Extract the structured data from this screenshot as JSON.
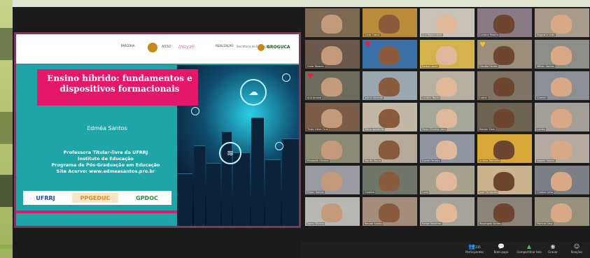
{
  "slide": {
    "title": "Ensino híbrido: fundamentos e dispositivos formacionais",
    "author": "Edméa Santos",
    "affiliation_lines": [
      "Professora Titular-livre da UFRRJ",
      "Instituto de Educação",
      "Programa de Pós-Graduação em Educação",
      "Site Acervo: www.edmeasantos.pro.br"
    ],
    "header_labels": {
      "partnership": "PARCERIA",
      "realization": "REALIZAÇÃO"
    },
    "header_logos": [
      "ASSO",
      "Inbyzê",
      "Secretaria de Educação",
      "GROGUCA"
    ],
    "footer_logos": [
      "UFRRJ",
      "PPGEDUC",
      "GPDOC"
    ]
  },
  "participants": [
    {
      "name": ""
    },
    {
      "name": "Carla Cabral"
    },
    {
      "name": "Ana Nascimento"
    },
    {
      "name": "Luciene Pereira"
    },
    {
      "name": "Nogueira Leite"
    },
    {
      "name": "Carla Tavares"
    },
    {
      "name": ""
    },
    {
      "name": "Raissa Lopes"
    },
    {
      "name": "Claudio Fontes"
    },
    {
      "name": "Willian Santos"
    },
    {
      "name": "Ana Amaral"
    },
    {
      "name": "Joilma Almeida"
    },
    {
      "name": "Luciana Rocha"
    },
    {
      "name": "Luana"
    },
    {
      "name": "Carmen"
    },
    {
      "name": "Thais Vieira Cruz"
    },
    {
      "name": "Maria Aparecida"
    },
    {
      "name": "Paula Oliveira Lima"
    },
    {
      "name": "Ramon Silva"
    },
    {
      "name": "Lurdes"
    },
    {
      "name": "Elisabete Oliveira"
    },
    {
      "name": "Marilia Souza"
    },
    {
      "name": "Daniel Ferreira"
    },
    {
      "name": "Andrea Ramalho"
    },
    {
      "name": "Isabela Santos"
    },
    {
      "name": "Edson Santos"
    },
    {
      "name": "Carolina"
    },
    {
      "name": "Lucia"
    },
    {
      "name": "Jose Fernandes"
    },
    {
      "name": "Cristina Lima"
    },
    {
      "name": "Joana Oliveira"
    },
    {
      "name": "Renata Santos"
    },
    {
      "name": "Rafael Medeiros"
    },
    {
      "name": "Rosangela Santos"
    },
    {
      "name": "Patricia Lima"
    }
  ],
  "toolbar": {
    "items": [
      {
        "label": "Participantes",
        "count": "235",
        "icon": "people-icon"
      },
      {
        "label": "Bate-papo",
        "icon": "chat-icon"
      },
      {
        "label": "Compartilhar tela",
        "icon": "share-screen-icon"
      },
      {
        "label": "Gravar",
        "icon": "record-icon"
      },
      {
        "label": "Reações",
        "icon": "reactions-icon"
      }
    ]
  },
  "colors": {
    "slide_border": "#7a3b5c",
    "slide_teal": "#1fa4a8",
    "title_pink": "#e5176b",
    "share_green": "#3bc45b"
  }
}
